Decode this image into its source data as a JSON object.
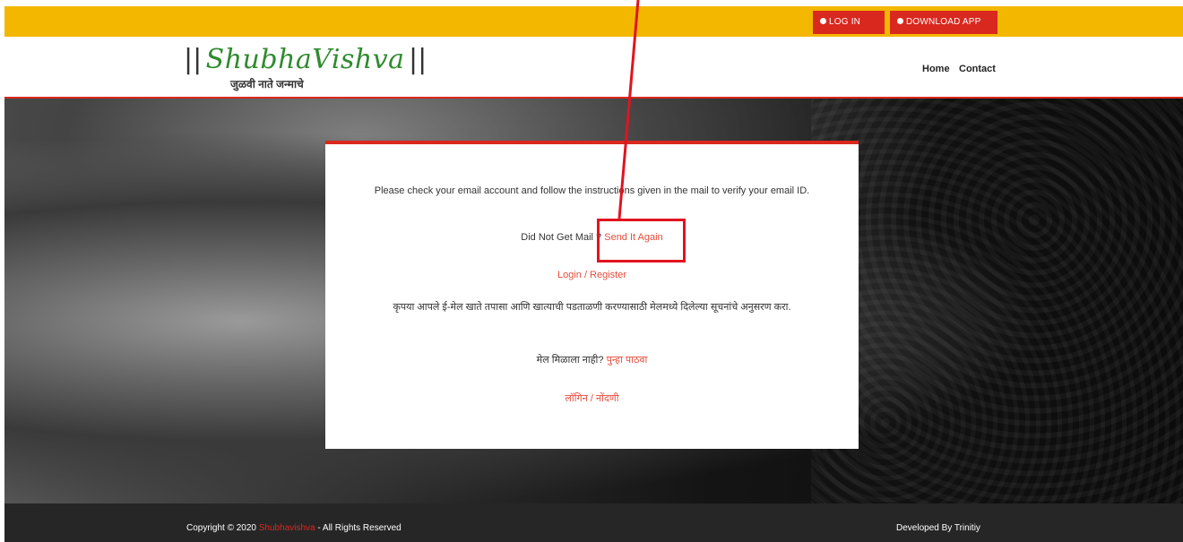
{
  "topbar": {
    "login_label": "LOG IN",
    "download_label": "DOWNLOAD APP"
  },
  "logo": {
    "bars_left": "||",
    "name": "ShubhaVishva",
    "bars_right": "||",
    "tagline": "जुळवी नाते जन्माचे"
  },
  "nav": {
    "home": "Home",
    "contact": "Contact"
  },
  "card": {
    "instructions_en": "Please check your email account and follow the instructions given in the mail to verify your email ID.",
    "did_not_get": "Did Not Get Mail ?",
    "send_again": "Send It Again",
    "login_register": "Login / Register",
    "instructions_mr": "कृपया आपले ई-मेल खाते तपासा आणि खात्याची पडताळणी करण्यासाठी मेलमध्ये दिलेल्या सूचनांचे अनुसरण करा.",
    "did_not_get_mr": "मेल मिळाला नाही?",
    "send_again_mr": "पुन्हा पाठवा",
    "login_register_mr": "लॉगिन / नोंदणी"
  },
  "footer": {
    "copyright_prefix": "Copyright © 2020",
    "brand": "Shubhavishva",
    "rights": "- All Rights Reserved",
    "developer": "Developed By Trinitiy"
  },
  "colors": {
    "topbar": "#f3b700",
    "accent": "#d9281e",
    "logo_green": "#2e8b2e",
    "footer": "#262626",
    "annotation": "#e0141f"
  }
}
